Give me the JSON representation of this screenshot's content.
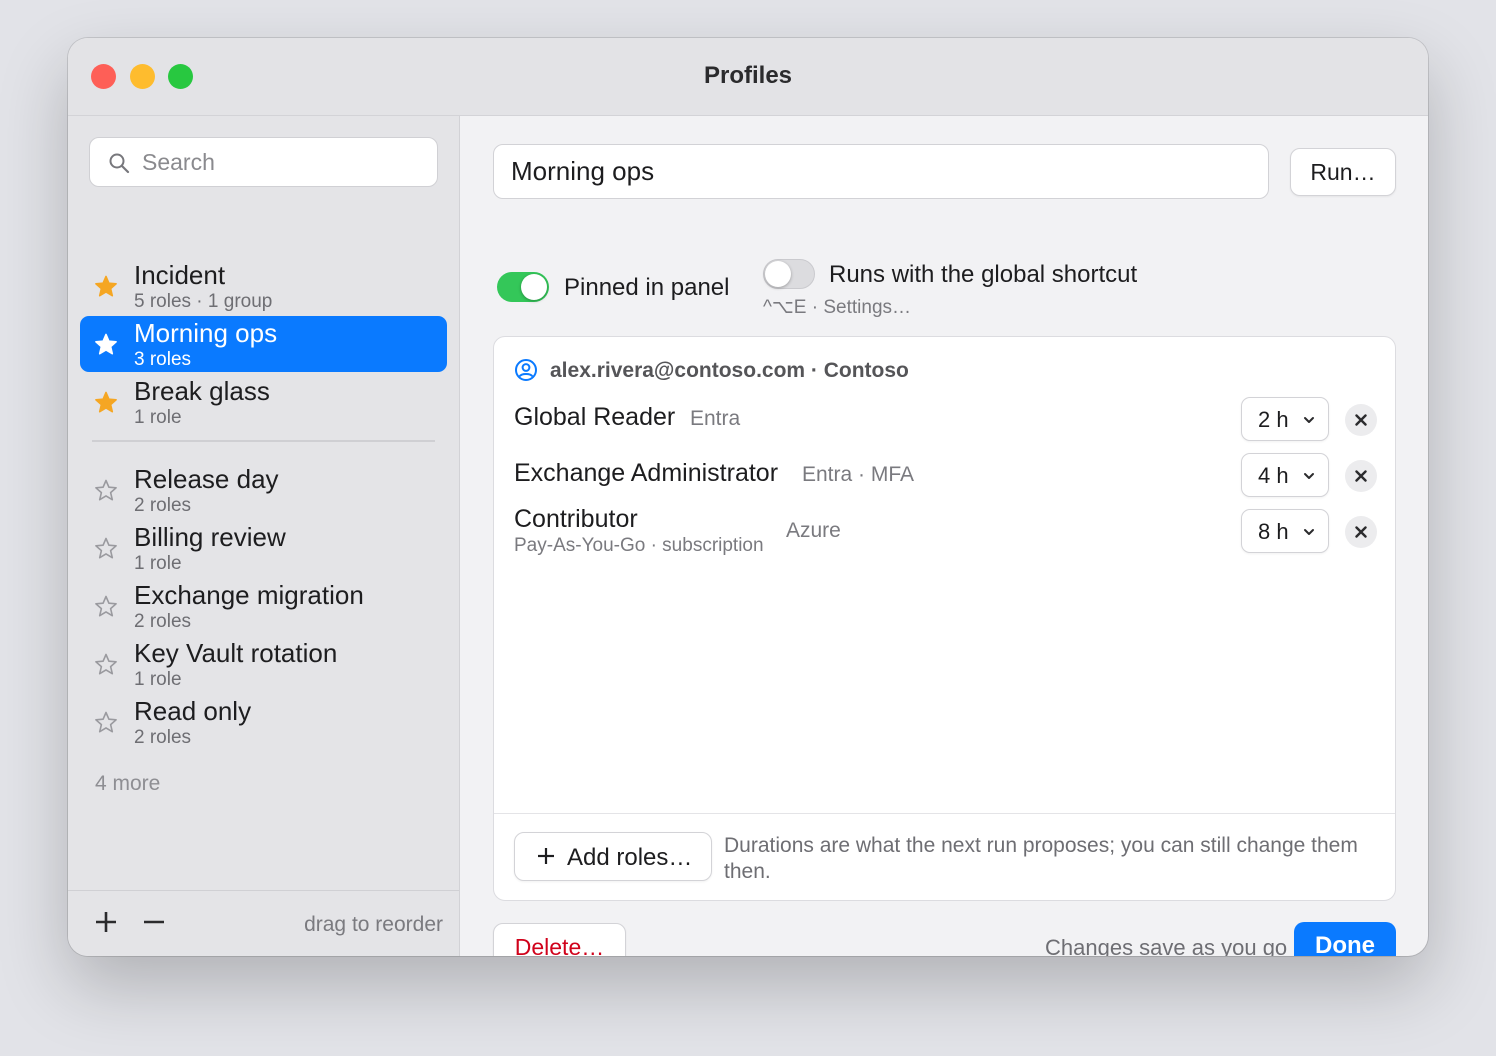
{
  "window": {
    "title": "Profiles"
  },
  "sidebar": {
    "search_placeholder": "Search",
    "profiles": [
      {
        "name": "Incident",
        "detail": "5 roles · 1 group",
        "starred": true,
        "selected": false
      },
      {
        "name": "Morning ops",
        "detail": "3 roles",
        "starred": true,
        "selected": true
      },
      {
        "name": "Break glass",
        "detail": "1 role",
        "starred": true,
        "selected": false
      },
      {
        "name": "Release day",
        "detail": "2 roles",
        "starred": false,
        "selected": false
      },
      {
        "name": "Billing review",
        "detail": "1 role",
        "starred": false,
        "selected": false
      },
      {
        "name": "Exchange migration",
        "detail": "2 roles",
        "starred": false,
        "selected": false
      },
      {
        "name": "Key Vault rotation",
        "detail": "1 role",
        "starred": false,
        "selected": false
      },
      {
        "name": "Read only",
        "detail": "2 roles",
        "starred": false,
        "selected": false
      }
    ],
    "more_label": "4 more",
    "add_label": "+",
    "remove_label": "−",
    "drag_hint": "drag to reorder"
  },
  "editor": {
    "profile_name": "Morning ops",
    "run_label": "Run…",
    "pinned": {
      "label": "Pinned in panel",
      "on": true
    },
    "shortcut": {
      "label": "Runs with the global shortcut",
      "hint": "^⌥E · Settings…",
      "on": false
    },
    "account": "alex.rivera@contoso.com · Contoso",
    "roles": [
      {
        "name": "Global Reader",
        "source": "Entra",
        "scope": "",
        "duration": "2 h"
      },
      {
        "name": "Exchange Administrator",
        "source": "Entra · MFA",
        "scope": "",
        "duration": "4 h"
      },
      {
        "name": "Contributor",
        "source": "Azure",
        "scope": "Pay-As-You-Go · subscription",
        "duration": "8 h"
      }
    ],
    "add_roles_label": "Add roles…",
    "footer_note": "Durations are what the next run proposes; you can still change them then.",
    "delete_label": "Delete…",
    "save_note": "Changes save as you go",
    "done_label": "Done"
  },
  "colors": {
    "accent": "#0a7aff",
    "star": "#f5a623",
    "toggle_on": "#34c759",
    "destructive": "#d0021b"
  }
}
